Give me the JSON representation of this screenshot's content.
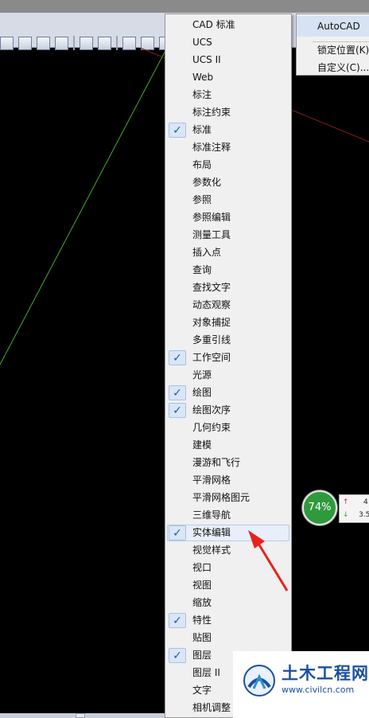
{
  "toolbar_menu": {
    "items": [
      {
        "label": "CAD 标准",
        "checked": false
      },
      {
        "label": "UCS",
        "checked": false
      },
      {
        "label": "UCS II",
        "checked": false
      },
      {
        "label": "Web",
        "checked": false
      },
      {
        "label": "标注",
        "checked": false
      },
      {
        "label": "标注约束",
        "checked": false
      },
      {
        "label": "标准",
        "checked": true
      },
      {
        "label": "标准注释",
        "checked": false
      },
      {
        "label": "布局",
        "checked": false
      },
      {
        "label": "参数化",
        "checked": false
      },
      {
        "label": "参照",
        "checked": false
      },
      {
        "label": "参照编辑",
        "checked": false
      },
      {
        "label": "测量工具",
        "checked": false
      },
      {
        "label": "插入点",
        "checked": false
      },
      {
        "label": "查询",
        "checked": false
      },
      {
        "label": "查找文字",
        "checked": false
      },
      {
        "label": "动态观察",
        "checked": false
      },
      {
        "label": "对象捕捉",
        "checked": false
      },
      {
        "label": "多重引线",
        "checked": false
      },
      {
        "label": "工作空间",
        "checked": true
      },
      {
        "label": "光源",
        "checked": false
      },
      {
        "label": "绘图",
        "checked": true
      },
      {
        "label": "绘图次序",
        "checked": true
      },
      {
        "label": "几何约束",
        "checked": false
      },
      {
        "label": "建模",
        "checked": false
      },
      {
        "label": "漫游和飞行",
        "checked": false
      },
      {
        "label": "平滑网格",
        "checked": false
      },
      {
        "label": "平滑网格图元",
        "checked": false
      },
      {
        "label": "三维导航",
        "checked": false
      },
      {
        "label": "实体编辑",
        "checked": true,
        "highlighted": true
      },
      {
        "label": "视觉样式",
        "checked": false
      },
      {
        "label": "视口",
        "checked": false
      },
      {
        "label": "视图",
        "checked": false
      },
      {
        "label": "缩放",
        "checked": false
      },
      {
        "label": "特性",
        "checked": true
      },
      {
        "label": "贴图",
        "checked": false
      },
      {
        "label": "图层",
        "checked": true
      },
      {
        "label": "图层 II",
        "checked": false
      },
      {
        "label": "文字",
        "checked": false
      },
      {
        "label": "相机调整",
        "checked": false
      }
    ],
    "check_glyph": "✓"
  },
  "submenu": {
    "header": "AutoCAD",
    "items": [
      "锁定位置(K)",
      "自定义(C)..."
    ]
  },
  "network_widget": {
    "percent": "74%",
    "up_value": "4",
    "down_value": "3.5",
    "up_arrow": "↑",
    "down_arrow": "↓"
  },
  "watermark": {
    "title": "土木工程网",
    "url": "www.civilcn.com"
  },
  "colors": {
    "canvas_bg": "#000000",
    "annotation_arrow": "#e8221b",
    "gauge_green": "#2f9a3c",
    "check_blue": "#1c5cb3"
  }
}
